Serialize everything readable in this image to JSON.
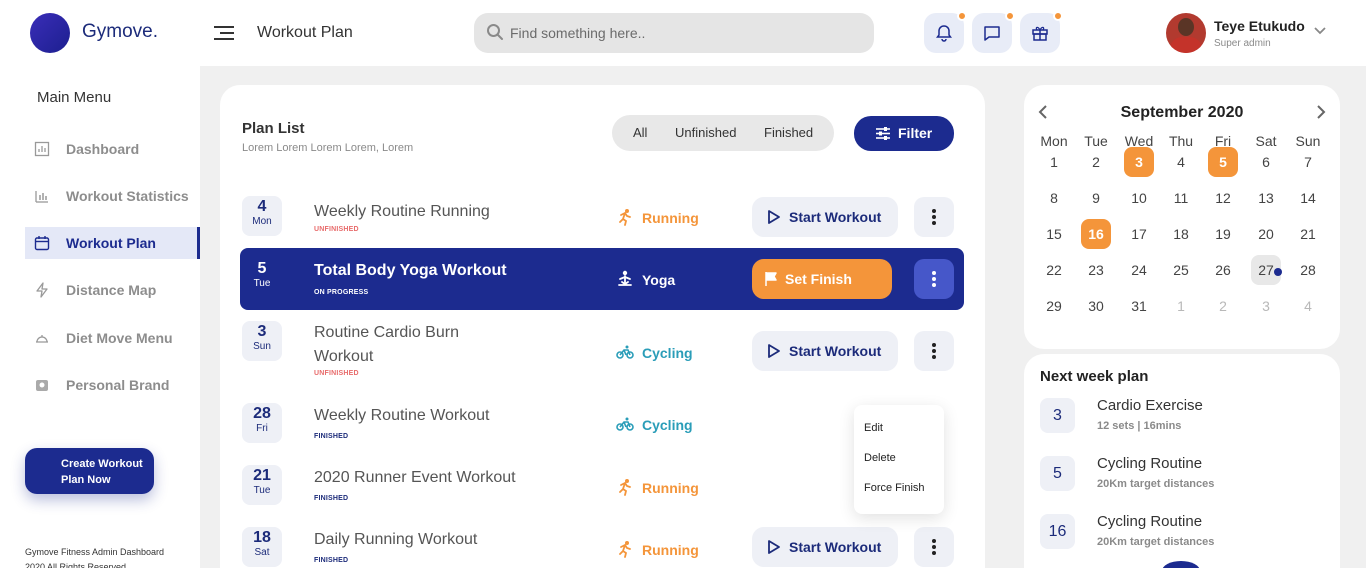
{
  "header": {
    "brand": "Gymove.",
    "page_title": "Workout Plan",
    "search_placeholder": "Find something here..",
    "user_name": "Teye Etukudo",
    "user_role": "Super admin",
    "accent_color": "#1c2b8f",
    "badge_color": "#f4953a"
  },
  "sidebar": {
    "title": "Main Menu",
    "items": [
      {
        "label": "Dashboard",
        "icon": "dashboard-icon"
      },
      {
        "label": "Workout Statistics",
        "icon": "bar-chart-icon"
      },
      {
        "label": "Workout Plan",
        "icon": "calendar-icon",
        "active": true
      },
      {
        "label": "Distance Map",
        "icon": "lightning-icon"
      },
      {
        "label": "Diet Move Menu",
        "icon": "food-icon"
      },
      {
        "label": "Personal Brand",
        "icon": "badge-icon"
      }
    ],
    "create_button": "Create Workout Plan Now",
    "footer_line1": "Gymove Fitness Admin Dashboard",
    "footer_line2": "2020 All Rights Reserved"
  },
  "plan": {
    "title": "Plan List",
    "subtitle": "Lorem Lorem Lorem Lorem, Lorem",
    "tabs": [
      "All",
      "Unfinished",
      "Finished"
    ],
    "filter_label": "Filter",
    "start_label": "Start Workout",
    "finish_label": "Set Finish",
    "rows": [
      {
        "day": "4",
        "dow": "Mon",
        "name": "Weekly Routine Running",
        "status": "UNFINISHED",
        "activity": "Running"
      },
      {
        "day": "5",
        "dow": "Tue",
        "name": "Total Body Yoga Workout",
        "status": "ON PROGRESS",
        "activity": "Yoga"
      },
      {
        "day": "3",
        "dow": "Sun",
        "name": "Routine Cardio Burn Workout",
        "status": "UNFINISHED",
        "activity": "Cycling"
      },
      {
        "day": "28",
        "dow": "Fri",
        "name": "Weekly Routine Workout",
        "status": "FINISHED",
        "activity": "Cycling"
      },
      {
        "day": "21",
        "dow": "Tue",
        "name": "2020 Runner Event Workout",
        "status": "FINISHED",
        "activity": "Running"
      },
      {
        "day": "18",
        "dow": "Sat",
        "name": "Daily Running Workout",
        "status": "FINISHED",
        "activity": "Running"
      }
    ],
    "menu": [
      "Edit",
      "Delete",
      "Force Finish"
    ]
  },
  "calendar": {
    "title": "September 2020",
    "weekdays": [
      "Mon",
      "Tue",
      "Wed",
      "Thu",
      "Fri",
      "Sat",
      "Sun"
    ],
    "days": [
      [
        "1",
        "2",
        "3",
        "4",
        "5",
        "6",
        "7"
      ],
      [
        "8",
        "9",
        "10",
        "11",
        "12",
        "13",
        "14"
      ],
      [
        "15",
        "16",
        "17",
        "18",
        "19",
        "20",
        "21"
      ],
      [
        "22",
        "23",
        "24",
        "25",
        "26",
        "27",
        "28"
      ],
      [
        "29",
        "30",
        "31",
        "1",
        "2",
        "3",
        "4"
      ]
    ]
  },
  "next_week": {
    "title": "Next week plan",
    "items": [
      {
        "num": "3",
        "name": "Cardio Exercise",
        "desc": "12 sets | 16mins"
      },
      {
        "num": "5",
        "name": "Cycling Routine",
        "desc": "20Km target distances"
      },
      {
        "num": "16",
        "name": "Cycling Routine",
        "desc": "20Km target distances"
      }
    ]
  }
}
